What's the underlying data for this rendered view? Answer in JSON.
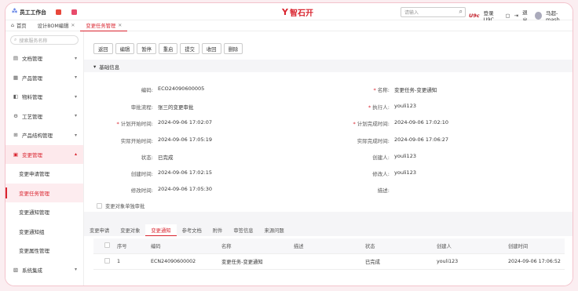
{
  "header": {
    "app_name": "员工工作台",
    "logo_text": "智石开",
    "search_placeholder": "请输入",
    "u9c_badge": "U9c",
    "login_label": "登录U9C",
    "logout_label": "退出",
    "user_name": "马超-mash..."
  },
  "tabs": [
    {
      "label": "首页"
    },
    {
      "label": "设计BOM编辑"
    },
    {
      "label": "变更任务管理"
    }
  ],
  "sidebar": {
    "search_placeholder": "搜索服务名称",
    "items": [
      {
        "label": "文档管理"
      },
      {
        "label": "产品管理"
      },
      {
        "label": "物料管理"
      },
      {
        "label": "工艺管理"
      },
      {
        "label": "产品结构管理"
      },
      {
        "label": "变更管理"
      }
    ],
    "subitems": [
      {
        "label": "变更申请管理"
      },
      {
        "label": "变更任务管理"
      },
      {
        "label": "变更通知管理"
      },
      {
        "label": "变更通知组"
      },
      {
        "label": "变更属性管理"
      }
    ],
    "bottom_item": {
      "label": "系统集成"
    }
  },
  "toolbar": {
    "buttons": [
      {
        "label": "返回"
      },
      {
        "label": "编辑"
      },
      {
        "label": "暂停"
      },
      {
        "label": "重启"
      },
      {
        "label": "提交"
      },
      {
        "label": "收回"
      },
      {
        "label": "删除"
      }
    ]
  },
  "section": {
    "title": "基础信息"
  },
  "form": {
    "code_label": "编码:",
    "code_value": "ECO24090600005",
    "name_label": "名称:",
    "name_value": "变更任务-变更通知",
    "flow_label": "审批流程:",
    "flow_value": "张三的变更审批",
    "executor_label": "执行人:",
    "executor_value": "youli123",
    "plan_start_label": "计划开始时间:",
    "plan_start_value": "2024-09-06 17:02:07",
    "plan_end_label": "计划完成时间:",
    "plan_end_value": "2024-09-06 17:02:10",
    "actual_start_label": "实际开始时间:",
    "actual_start_value": "2024-09-06 17:05:19",
    "actual_end_label": "实际完成时间:",
    "actual_end_value": "2024-09-06 17:06:27",
    "status_label": "状态:",
    "status_value": "已完成",
    "creator_label": "创建人:",
    "creator_value": "youli123",
    "created_label": "创建时间:",
    "created_value": "2024-09-06 17:02:15",
    "modifier_label": "修改人:",
    "modifier_value": "youli123",
    "modified_label": "修改时间:",
    "modified_value": "2024-09-06 17:05:30",
    "desc_label": "描述:",
    "check_label": "变更对象单独审批"
  },
  "subtabs": [
    {
      "label": "变更申请"
    },
    {
      "label": "变更对象"
    },
    {
      "label": "变更通知"
    },
    {
      "label": "参考文档"
    },
    {
      "label": "附件"
    },
    {
      "label": "审签信息"
    },
    {
      "label": "来源问题"
    }
  ],
  "table": {
    "headers": [
      "序号",
      "编码",
      "名称",
      "描述",
      "状态",
      "创建人",
      "创建时间"
    ],
    "rows": [
      [
        "1",
        "ECN24090600002",
        "变更任务-变更通知",
        "",
        "已完成",
        "youli123",
        "2024-09-06 17:06:52"
      ]
    ]
  },
  "colors": {
    "accent": "#d9242f",
    "frame": "#f3c3cc",
    "background": "#fbeef1"
  }
}
